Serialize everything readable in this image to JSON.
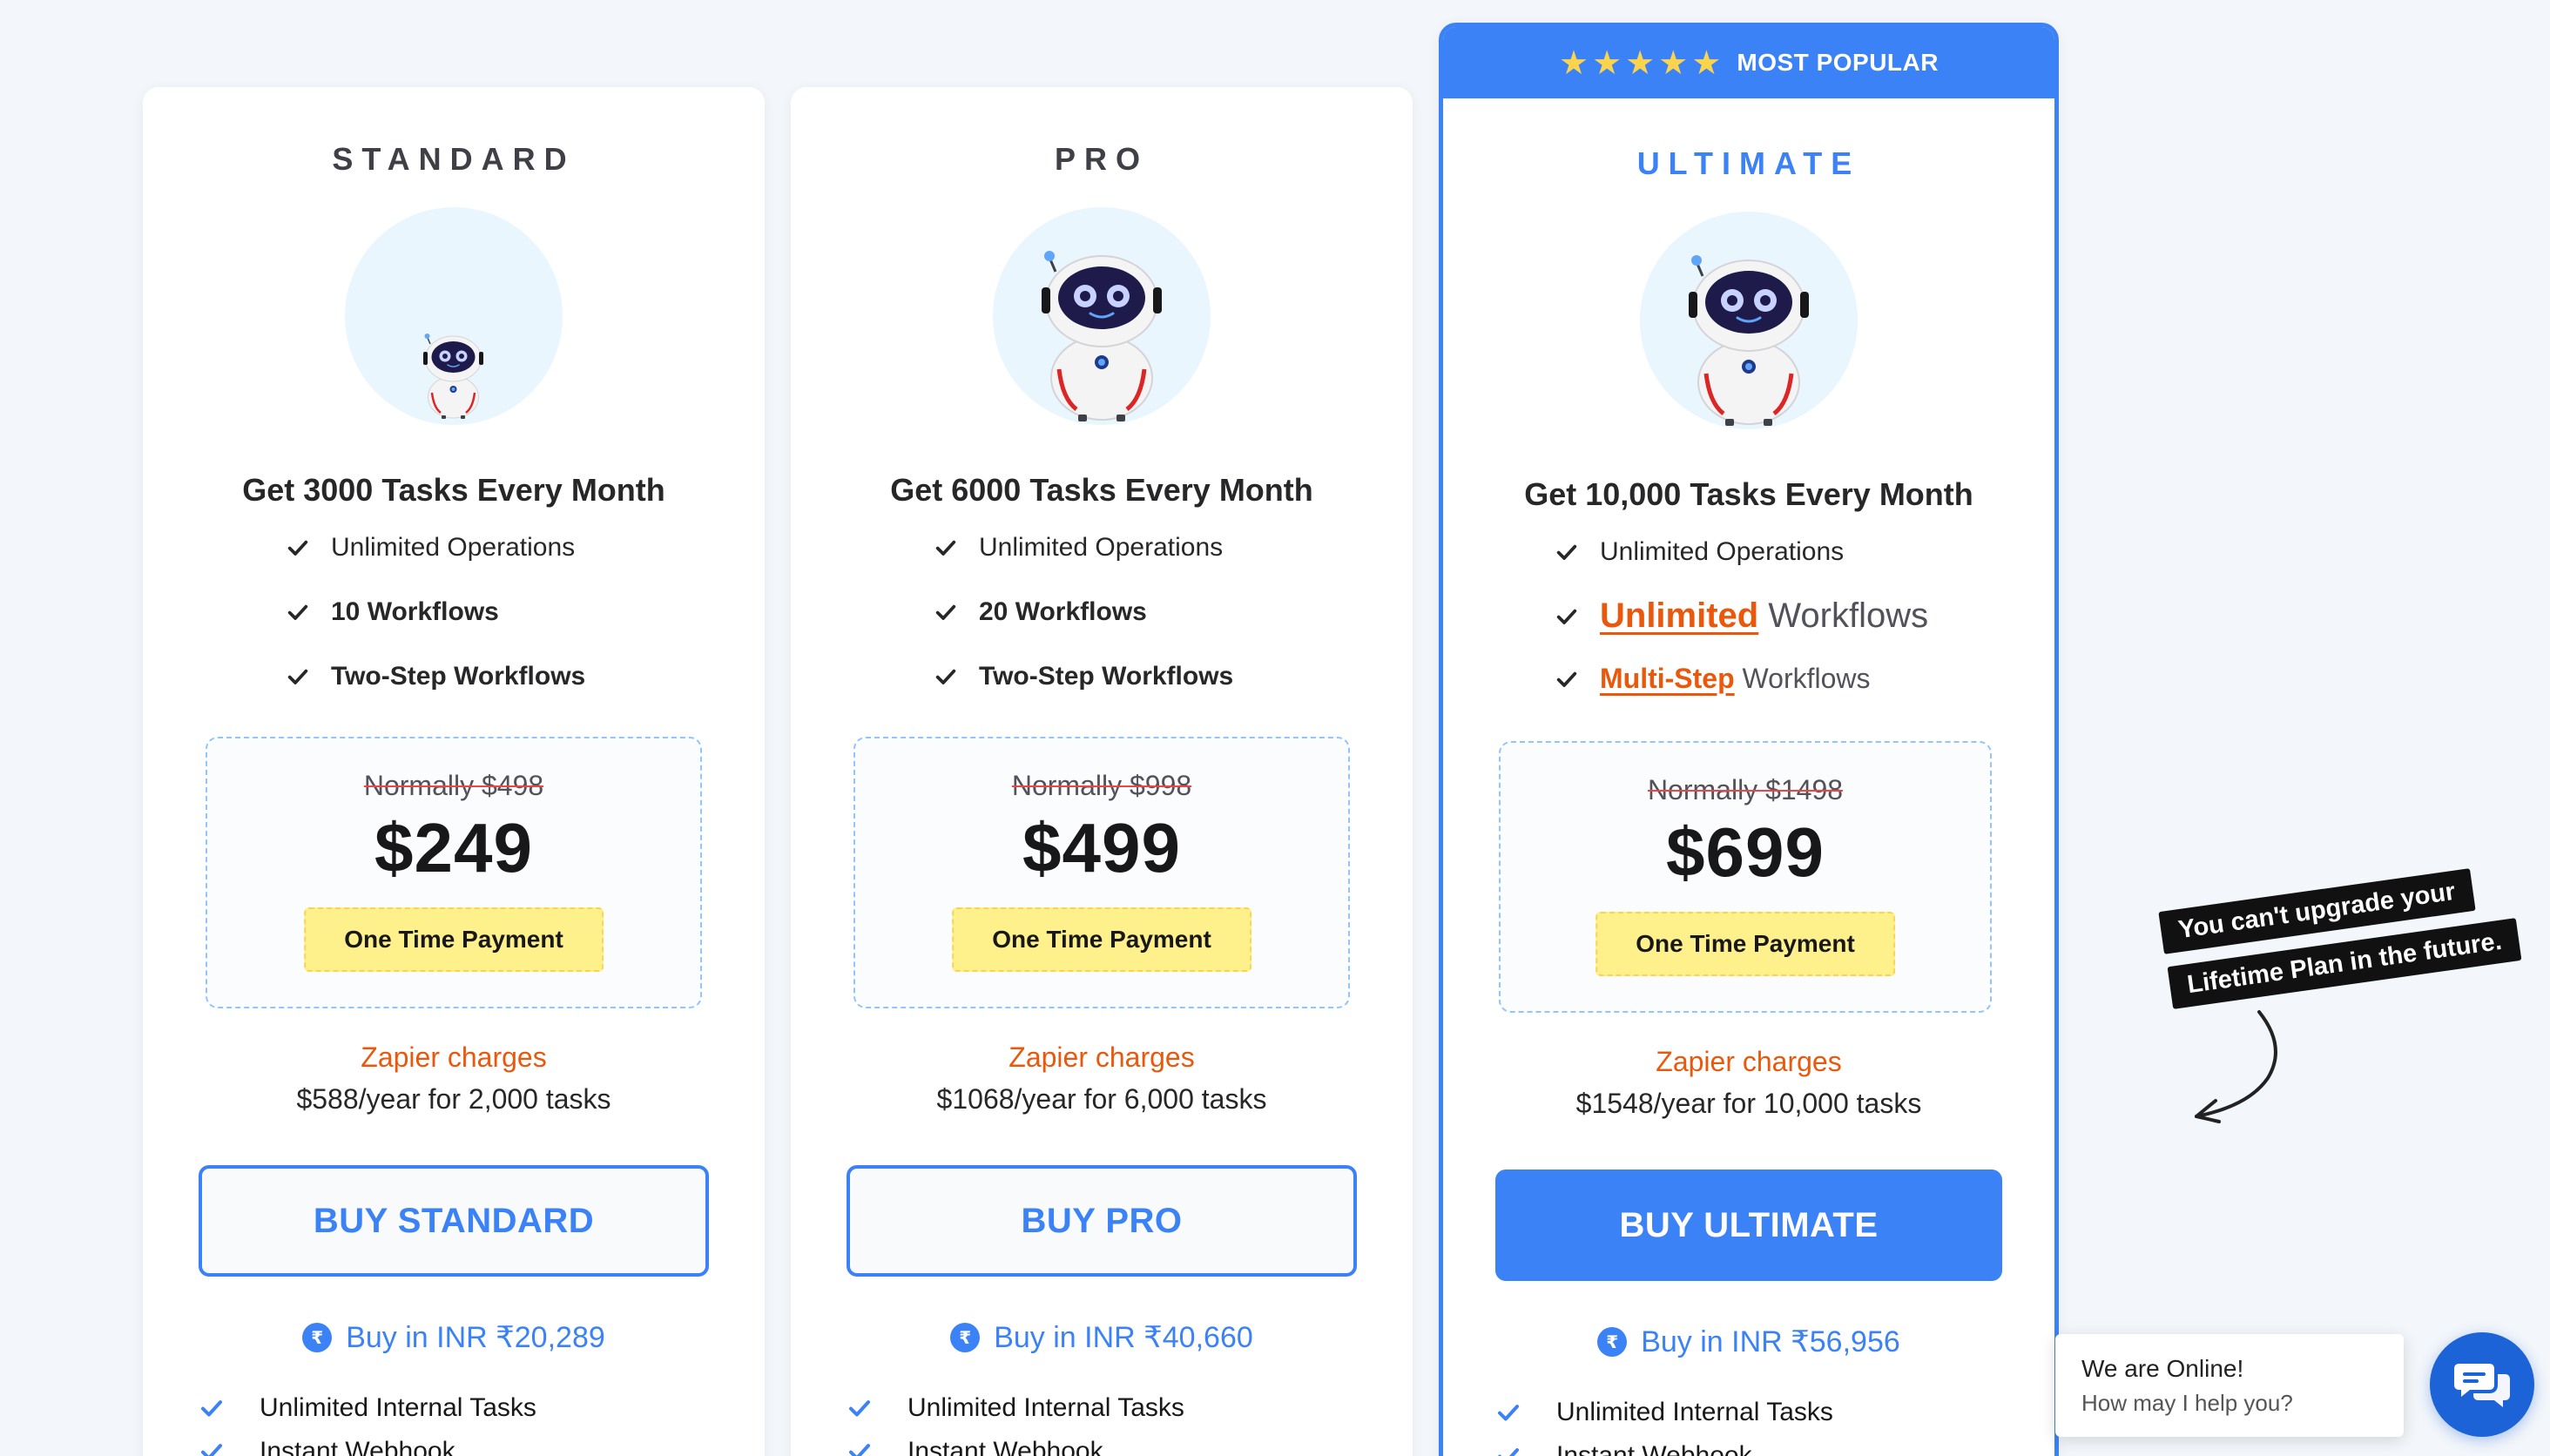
{
  "plans": [
    {
      "name": "STANDARD",
      "tasks_headline": "Get 3000 Tasks Every Month",
      "features": [
        "Unlimited Operations",
        "10 Workflows",
        "Two-Step Workflows"
      ],
      "normal_price": "Normally $498",
      "price": "$249",
      "payment_badge": "One Time Payment",
      "zapier_label": "Zapier charges",
      "zapier_detail": "$588/year for 2,000 tasks",
      "buy_label": "BUY STANDARD",
      "inr_label": "Buy in INR ₹20,289",
      "perks": [
        "Unlimited Internal Tasks",
        "Instant Webhook"
      ]
    },
    {
      "name": "PRO",
      "tasks_headline": "Get 6000 Tasks Every Month",
      "features": [
        "Unlimited Operations",
        "20 Workflows",
        "Two-Step Workflows"
      ],
      "normal_price": "Normally $998",
      "price": "$499",
      "payment_badge": "One Time Payment",
      "zapier_label": "Zapier charges",
      "zapier_detail": "$1068/year for 6,000 tasks",
      "buy_label": "BUY PRO",
      "inr_label": "Buy in INR ₹40,660",
      "perks": [
        "Unlimited Internal Tasks",
        "Instant Webhook"
      ]
    },
    {
      "name": "ULTIMATE",
      "popular_label": "MOST POPULAR",
      "tasks_headline": "Get 10,000 Tasks Every Month",
      "features": [
        "Unlimited Operations"
      ],
      "feature_unlimited_strong": "Unlimited",
      "feature_unlimited_rest": "Workflows",
      "feature_multistep_strong": "Multi-Step",
      "feature_multistep_rest": "Workflows",
      "normal_price": "Normally $1498",
      "price": "$699",
      "payment_badge": "One Time Payment",
      "zapier_label": "Zapier charges",
      "zapier_detail": "$1548/year for 10,000 tasks",
      "buy_label": "BUY ULTIMATE",
      "inr_label": "Buy in INR ₹56,956",
      "perks": [
        "Unlimited Internal Tasks",
        "Instant Webhook"
      ]
    }
  ],
  "note": {
    "line1": "You can't upgrade your",
    "line2": "Lifetime Plan in the future."
  },
  "chat": {
    "title": "We are Online!",
    "subtitle": "How may I help you?"
  },
  "icons": {
    "check": "check-icon",
    "rupee": "rupee-icon",
    "star": "star-icon",
    "chat": "chat-icon",
    "arrow": "curved-arrow-icon"
  },
  "colors": {
    "accent": "#3b82f6",
    "highlight": "#ea580c",
    "badge": "#fef08a",
    "star": "#fcd34d"
  }
}
